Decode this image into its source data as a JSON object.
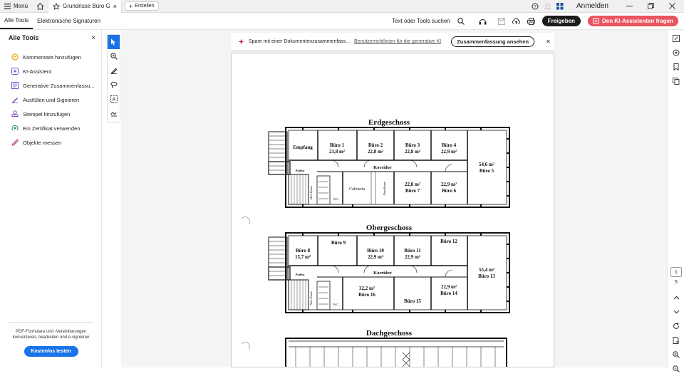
{
  "topbar": {
    "menu_label": "Menü",
    "tab_title": "Grundrisse Büro GR...",
    "create_label": "Erstellen",
    "signin_label": "Anmelden"
  },
  "secondary": {
    "tabs": [
      "Alle Tools",
      "Elektronische Signaturen"
    ],
    "search_label": "Text oder Tools suchen",
    "share_label": "Freigeben",
    "ai_label": "Den KI-Assistenten fragen"
  },
  "left_panel": {
    "title": "Alle Tools",
    "items": [
      {
        "label": "Kommentare hinzufügen",
        "icon": "comment-icon",
        "color": "#e8a400"
      },
      {
        "label": "KI-Assistent",
        "icon": "ai-assistant-icon",
        "color": "#6b4fc9"
      },
      {
        "label": "Generative Zusammenfassu...",
        "icon": "summary-icon",
        "color": "#6b4fc9"
      },
      {
        "label": "Ausfüllen und Signieren",
        "icon": "sign-icon",
        "color": "#7b3fb5"
      },
      {
        "label": "Stempel hinzufügen",
        "icon": "stamp-icon",
        "color": "#7b3fb5"
      },
      {
        "label": "Ein Zertifikat verwenden",
        "icon": "certificate-icon",
        "color": "#2a8a8a"
      },
      {
        "label": "Objekte messen",
        "icon": "measure-icon",
        "color": "#b3358a"
      }
    ],
    "footer_text": "PDF-Formulare und -Vereinbarungen konvertieren, bearbeiten und e-signieren",
    "try_button": "Kostenlos testen"
  },
  "notice": {
    "text": "Spare mit einer Dokumentenzusammenfass...",
    "link": "Benutzerrichtlinien für die generative KI",
    "button": "Zusammenfassung ansehen"
  },
  "document": {
    "floors": [
      {
        "title": "Erdgeschoss",
        "rooms_top": [
          {
            "name": "Empfang",
            "area": ""
          },
          {
            "name": "Büro 1",
            "area": "21,8 m²"
          },
          {
            "name": "Büro 2",
            "area": "22,8 m²"
          },
          {
            "name": "Büro 3",
            "area": "22,8 m²"
          },
          {
            "name": "Büro 4",
            "area": "22,9 m²"
          }
        ],
        "rooms_bottom": [
          {
            "name": "Cafeteria",
            "area": ""
          },
          {
            "name": "Büro 7",
            "area": "22,8 m²"
          },
          {
            "name": "Büro 6",
            "area": "22,9 m²"
          }
        ],
        "big_room": {
          "name": "Büro 5",
          "area": "54,6 m²"
        },
        "corridor": "Korridor",
        "landing": "Podest",
        "wc": "W.C.",
        "storage": "Abstellraum",
        "staircase": "Abst.-Raum"
      },
      {
        "title": "Obergeschoss",
        "rooms_top": [
          {
            "name": "Büro 8",
            "area": "15,7 m²"
          },
          {
            "name": "Büro 9",
            "area": ""
          },
          {
            "name": "Büro 10",
            "area": "22,9 m²"
          },
          {
            "name": "Büro 11",
            "area": "22,9 m²"
          },
          {
            "name": "Büro 12",
            "area": ""
          }
        ],
        "rooms_bottom": [
          {
            "name": "Büro 16",
            "area": "32,2 m²"
          },
          {
            "name": "Büro 15",
            "area": ""
          },
          {
            "name": "Büro 14",
            "area": "22,9 m²"
          }
        ],
        "big_room": {
          "name": "Büro 13",
          "area": "55,4 m²"
        },
        "corridor": "Korridor",
        "landing": "Podest",
        "wc": "W.C.",
        "staircase": "Abst.-Raum"
      },
      {
        "title": "Dachgeschoss"
      }
    ]
  },
  "right_rail": {
    "current_page": "1",
    "total_pages": "5"
  }
}
